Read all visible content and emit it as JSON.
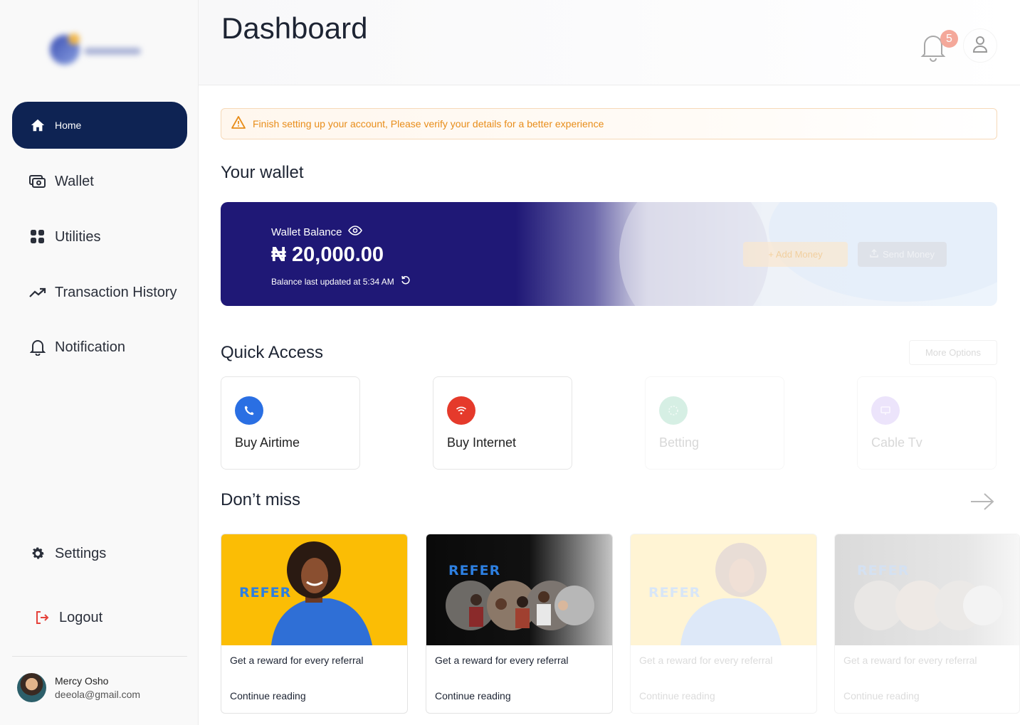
{
  "sidebar": {
    "items": [
      {
        "label": "Home",
        "icon": "home-icon"
      },
      {
        "label": "Wallet",
        "icon": "wallet-icon"
      },
      {
        "label": "Utilities",
        "icon": "grid-icon"
      },
      {
        "label": "Transaction History",
        "icon": "trend-up-icon"
      },
      {
        "label": "Notification",
        "icon": "bell-icon"
      },
      {
        "label": "Settings",
        "icon": "gear-icon"
      },
      {
        "label": "Logout",
        "icon": "logout-icon"
      }
    ],
    "user": {
      "name": "Mercy Osho",
      "email": "deeola@gmail.com"
    }
  },
  "header": {
    "title": "Dashboard",
    "notification_count": "5"
  },
  "alert": {
    "text": "Finish setting up your account, Please verify your details for a better experience"
  },
  "wallet": {
    "section_title": "Your wallet",
    "balance_label": "Wallet Balance",
    "balance": "₦ 20,000.00",
    "updated": "Balance last updated at 5:34 AM",
    "add_money": "+ Add Money",
    "send_money": "Send Money"
  },
  "quick_access": {
    "title": "Quick Access",
    "more": "More Options",
    "items": [
      {
        "label": "Buy Airtime",
        "color": "#2a6fe3"
      },
      {
        "label": "Buy Internet",
        "color": "#e53a2b"
      },
      {
        "label": "Betting",
        "color": "#d6efe4"
      },
      {
        "label": "Cable Tv",
        "color": "#ece4fb"
      }
    ]
  },
  "dont_miss": {
    "title": "Don’t miss",
    "cards": [
      {
        "refer": "REFER",
        "title": "Get a reward for every referral",
        "link": "Continue reading"
      },
      {
        "refer": "REFER",
        "title": "Get a reward for every referral",
        "link": "Continue reading"
      },
      {
        "refer": "REFER",
        "title": "Get a reward for every referral",
        "link": "Continue reading"
      },
      {
        "refer": "REFER",
        "title": "Get a reward for every referral",
        "link": "Continue reading"
      }
    ]
  }
}
